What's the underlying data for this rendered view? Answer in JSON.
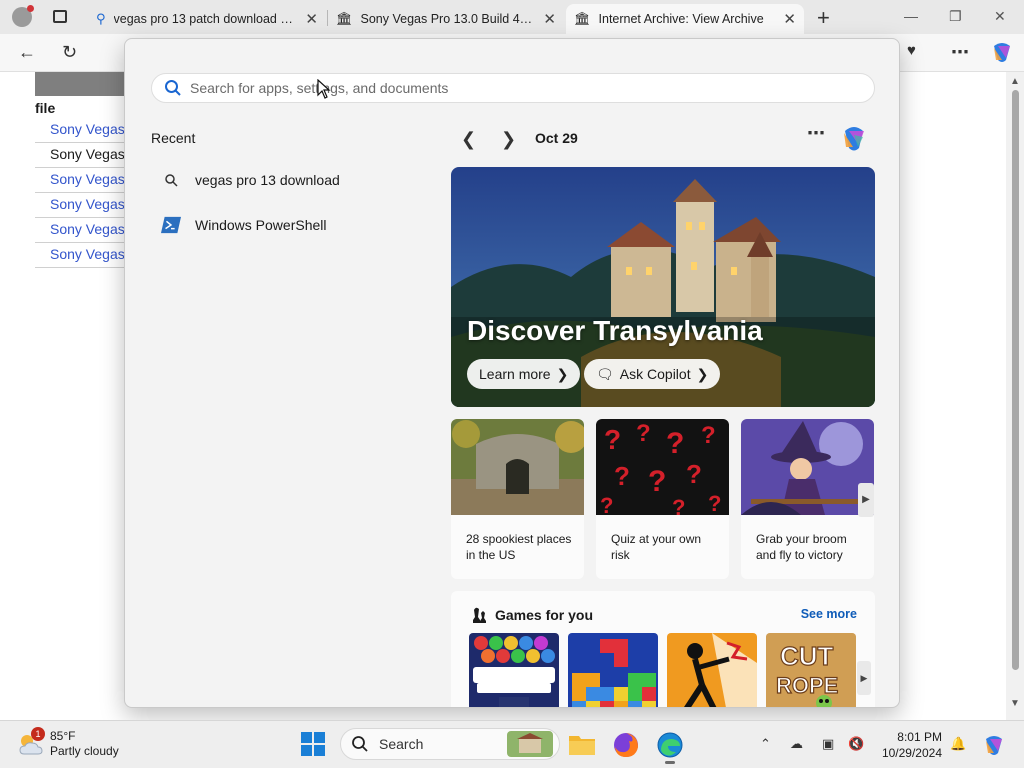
{
  "browser": {
    "tabs": [
      {
        "title": "vegas pro 13 patch download - S",
        "active": false
      },
      {
        "title": "Sony Vegas Pro 13.0 Build 453 (x",
        "active": false
      },
      {
        "title": "Internet Archive: View Archive",
        "active": true
      }
    ]
  },
  "page": {
    "file_header": "file",
    "rows": [
      {
        "text": "Sony Vegas",
        "link": true
      },
      {
        "text": "Sony Vegas",
        "link": false
      },
      {
        "text": "Sony Vegas",
        "link": true
      },
      {
        "text": "Sony Vegas",
        "link": true
      },
      {
        "text": "Sony Vegas",
        "link": true
      },
      {
        "text": "Sony Vegas",
        "link": true
      }
    ]
  },
  "start": {
    "search_placeholder": "Search for apps, settings, and documents",
    "recent_title": "Recent",
    "recent": [
      {
        "label": "vegas pro 13 download",
        "icon": "search-icon"
      },
      {
        "label": "Windows PowerShell",
        "icon": "powershell-icon"
      }
    ],
    "date": "Oct 29",
    "hero": {
      "title": "Discover Transylvania",
      "learn_more": "Learn more",
      "ask_copilot": "Ask Copilot"
    },
    "cards": [
      {
        "text": "28 spookiest places in the US"
      },
      {
        "text": "Quiz at your own risk"
      },
      {
        "text": "Grab your broom and fly to victory"
      }
    ],
    "games": {
      "title": "Games for you",
      "see_more": "See more"
    }
  },
  "taskbar": {
    "weather_temp": "85°F",
    "weather_desc": "Partly cloudy",
    "weather_badge": "1",
    "search_label": "Search",
    "time": "8:01 PM",
    "date": "10/29/2024"
  }
}
